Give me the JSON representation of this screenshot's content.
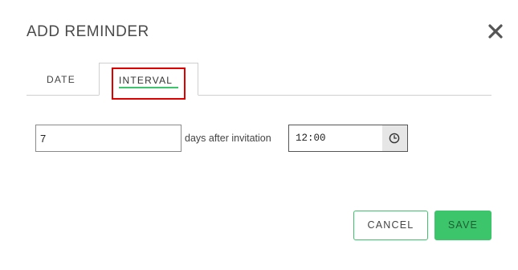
{
  "dialog": {
    "title": "ADD REMINDER",
    "close_icon": "close-icon"
  },
  "tabs": [
    {
      "label": "DATE",
      "active": false
    },
    {
      "label": "INTERVAL",
      "active": true
    }
  ],
  "form": {
    "days_value": "7",
    "days_label": "days after invitation",
    "time_value": "12:00",
    "time_icon": "clock-icon"
  },
  "footer": {
    "cancel_label": "CANCEL",
    "save_label": "SAVE"
  },
  "colors": {
    "accent": "#3cc56b",
    "highlight": "#e00000"
  }
}
